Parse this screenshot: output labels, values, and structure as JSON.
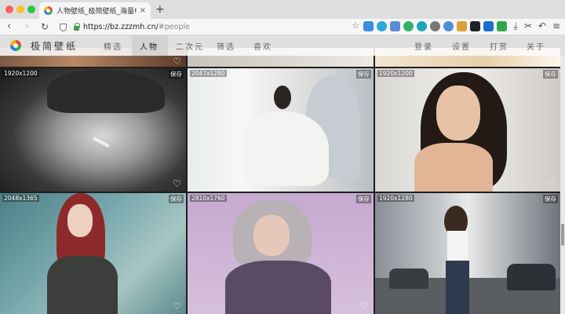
{
  "browser": {
    "tab_title": "人物壁纸_极简壁纸_海量电脑桌",
    "tab_close": "×",
    "new_tab": "+",
    "url_host": "https://bz.zzzmh.cn/",
    "url_path": "#people"
  },
  "site": {
    "name": "极简壁纸",
    "nav": [
      "精选",
      "人物",
      "二次元",
      "筛选",
      "喜欢"
    ],
    "active_nav": "人物",
    "right_nav": [
      "登录",
      "设置",
      "打赏",
      "关于"
    ]
  },
  "grid": {
    "save_label": "保存",
    "rows": [
      [
        {
          "res": "1920x1200"
        },
        {
          "res": "2047x1280"
        },
        {
          "res": "1920x1200"
        }
      ],
      [
        {
          "res": "2048x1365"
        },
        {
          "res": "2810x1760"
        },
        {
          "res": "1920x1280"
        }
      ]
    ]
  },
  "colors": {
    "accent_tab": "#f6f6f6",
    "nav_active_bg": "#cdcdcd"
  }
}
